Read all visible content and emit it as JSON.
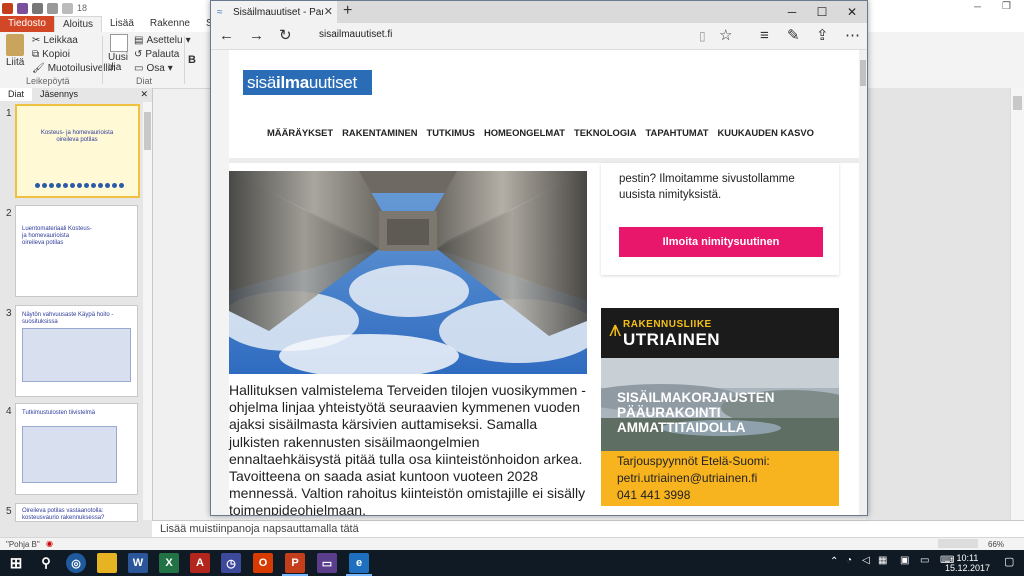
{
  "powerpoint": {
    "tabs": [
      "Tiedosto",
      "Aloitus",
      "Lisää",
      "Rakenne",
      "Siirtymät"
    ],
    "active_tab": "Aloitus",
    "ribbon": {
      "paste": "Liitä",
      "cut": "Leikkaa",
      "copy": "Kopioi",
      "format_painter": "Muotoilusivellin",
      "clipboard_group": "Leikepöytä",
      "new_slide": "Uusi dia",
      "layout": "Asettelu",
      "reset": "Palauta",
      "section": "Osa",
      "slides_group": "Diat",
      "font_size": "18"
    },
    "left_panel_tabs": [
      "Diat",
      "Jäsennys"
    ],
    "slides": [
      {
        "num": "1",
        "title": "Kosteus- ja homevaurioista oireileva potilas"
      },
      {
        "num": "2",
        "title": "Luentomateriaali Kosteus- ja homevaurioista oireileva potilas"
      },
      {
        "num": "3",
        "title": "Näytön vahvuusaste Käypä hoito -suosituksissa"
      },
      {
        "num": "4",
        "title": "Tutkimustulosten tiivistelmä"
      },
      {
        "num": "5",
        "title": "Oireileva potilas vastaanotolla: kosteusvaurio rakennuksessa?"
      }
    ],
    "notes_placeholder": "Lisää muistiinpanoja napsauttamalla tätä",
    "status_theme": "\"Pohja B\"",
    "zoom": "66%"
  },
  "taskbar": {
    "time": "10:11",
    "date": "15.12.2017"
  },
  "browser": {
    "tab_title": "Sisäilmauutiset - Paremp",
    "url": "sisailmauutiset.fi",
    "site": {
      "logo_part1": "sisä",
      "logo_part2": "ilma",
      "logo_part3": "uutiset",
      "nav": [
        "MÄÄRÄYKSET",
        "RAKENTAMINEN",
        "TUTKIMUS",
        "HOMEONGELMAT",
        "TEKNOLOGIA",
        "TAPAHTUMAT",
        "KUUKAUDEN KASVO"
      ],
      "sidebar_text": "pestin? Ilmoitamme sivustollamme uusista nimityksistä.",
      "notify_button": "Ilmoita nimitysuutinen",
      "article_text": "Hallituksen valmistelema Terveiden tilojen vuosikymmen -ohjelma linjaa yhteistyötä seuraavien kymmenen vuoden ajaksi sisäilmasta kärsivien auttamiseksi. Samalla julkisten rakennusten sisäilmaongelmien ennaltaehkäisystä pitää tulla osa kiinteistönhoidon arkea. Tavoitteena on saada asiat kuntoon vuoteen 2028 mennessä. Valtion rahoitus kiinteistön omistajille ei sisälly toimenpideohjelmaan.",
      "ad": {
        "brand_line1": "RAKENNUSLIIKE",
        "brand_line2": "UTRIAINEN",
        "headline": "SISÄILMAKORJAUSTEN PÄÄURAKOINTI AMMATTITAIDOLLA",
        "contact1": "Tarjouspyynnöt Etelä-Suomi:",
        "contact2": "petri.utriainen@utriainen.fi",
        "contact3": "041 441 3998"
      }
    }
  }
}
